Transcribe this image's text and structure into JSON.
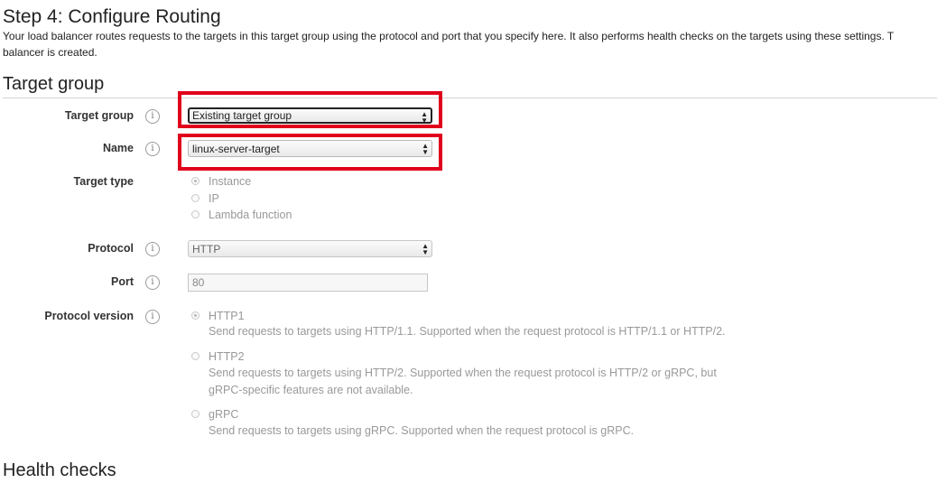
{
  "page": {
    "title": "Step 4: Configure Routing",
    "description": "Your load balancer routes requests to the targets in this target group using the protocol and port that you specify here. It also performs health checks on the targets using these settings. T",
    "description_line2": "balancer is created."
  },
  "target_group_section": {
    "heading": "Target group",
    "fields": {
      "target_group": {
        "label": "Target group",
        "value": "Existing target group"
      },
      "name": {
        "label": "Name",
        "value": "linux-server-target"
      },
      "target_type": {
        "label": "Target type",
        "options": [
          "Instance",
          "IP",
          "Lambda function"
        ],
        "selected": "Instance"
      },
      "protocol": {
        "label": "Protocol",
        "value": "HTTP"
      },
      "port": {
        "label": "Port",
        "value": "80"
      },
      "protocol_version": {
        "label": "Protocol version",
        "selected": "HTTP1",
        "options": [
          {
            "name": "HTTP1",
            "desc": "Send requests to targets using HTTP/1.1. Supported when the request protocol is HTTP/1.1 or HTTP/2."
          },
          {
            "name": "HTTP2",
            "desc": "Send requests to targets using HTTP/2. Supported when the request protocol is HTTP/2 or gRPC, but",
            "desc2": "gRPC-specific features are not available."
          },
          {
            "name": "gRPC",
            "desc": "Send requests to targets using gRPC. Supported when the request protocol is gRPC."
          }
        ]
      }
    }
  },
  "health_checks_section": {
    "heading": "Health checks"
  },
  "icons": {
    "info": "info-icon",
    "select_arrow": "updown-arrow-icon"
  },
  "colors": {
    "highlight": "#e0001b"
  }
}
